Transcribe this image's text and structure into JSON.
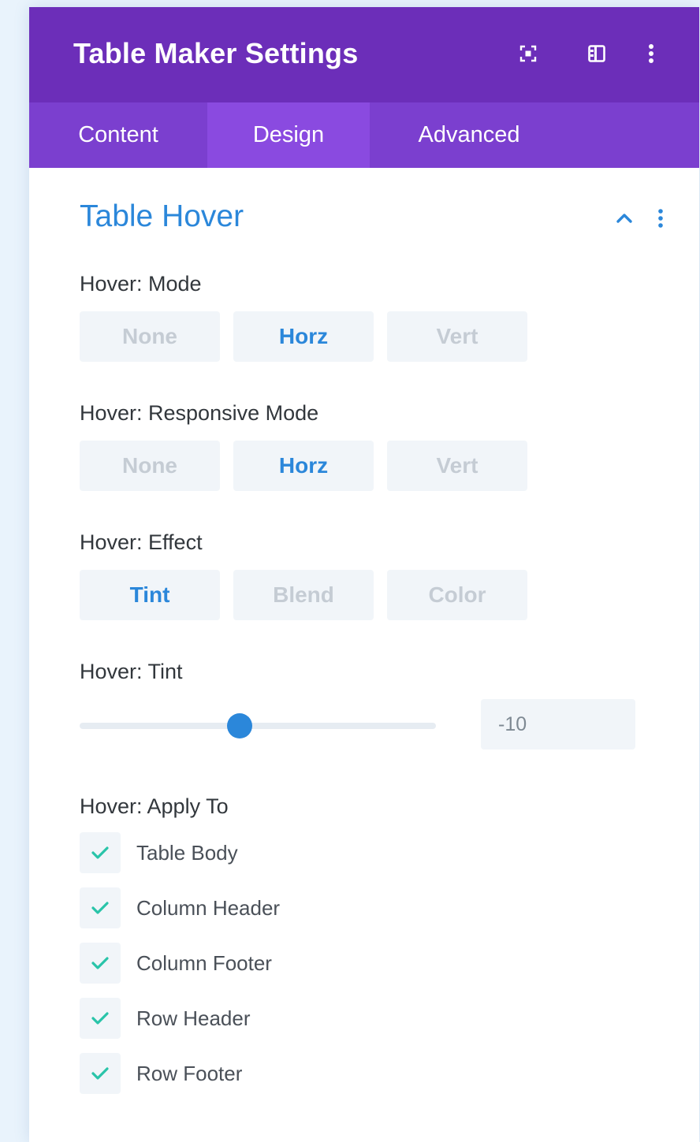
{
  "header": {
    "title": "Table Maker Settings",
    "icons": [
      "expand-icon",
      "layout-columns-icon",
      "more-vertical-icon"
    ]
  },
  "tabs": [
    {
      "label": "Content",
      "active": false
    },
    {
      "label": "Design",
      "active": true
    },
    {
      "label": "Advanced",
      "active": false
    }
  ],
  "section": {
    "title": "Table Hover",
    "icons": [
      "chevron-up-icon",
      "more-vertical-icon"
    ]
  },
  "hover_mode": {
    "label": "Hover: Mode",
    "options": [
      "None",
      "Horz",
      "Vert"
    ],
    "selected": "Horz"
  },
  "hover_responsive_mode": {
    "label": "Hover: Responsive Mode",
    "options": [
      "None",
      "Horz",
      "Vert"
    ],
    "selected": "Horz"
  },
  "hover_effect": {
    "label": "Hover: Effect",
    "options": [
      "Tint",
      "Blend",
      "Color"
    ],
    "selected": "Tint"
  },
  "hover_tint": {
    "label": "Hover: Tint",
    "value": "-10",
    "slider_fraction": 0.45
  },
  "hover_apply_to": {
    "label": "Hover: Apply To",
    "items": [
      {
        "label": "Table Body",
        "checked": true
      },
      {
        "label": "Column Header",
        "checked": true
      },
      {
        "label": "Column Footer",
        "checked": true
      },
      {
        "label": "Row Header",
        "checked": true
      },
      {
        "label": "Row Footer",
        "checked": true
      }
    ]
  },
  "colors": {
    "header_bg": "#6c2eb9",
    "tabs_bg": "#7b3fcf",
    "active_tab_bg": "#8a4ae0",
    "accent_blue": "#2b87da",
    "check_teal": "#29c4a9"
  }
}
